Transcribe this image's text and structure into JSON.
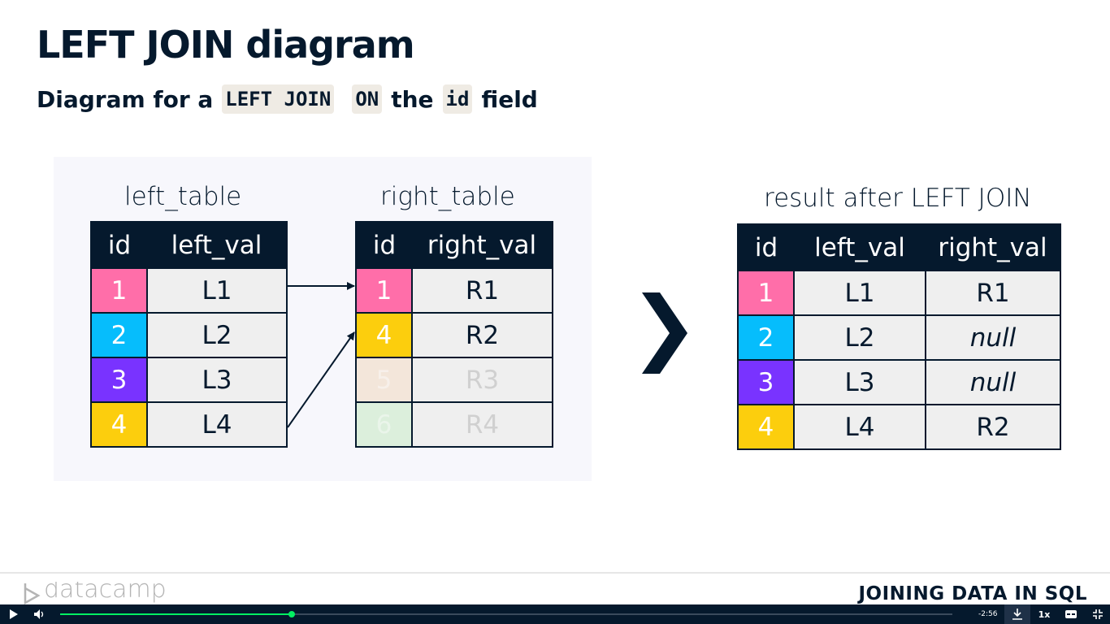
{
  "slide": {
    "title": "LEFT JOIN diagram",
    "subtitle": {
      "prefix": "Diagram for a",
      "code1": "LEFT JOIN",
      "code2": "ON",
      "mid": "the",
      "code3": "id",
      "suffix": "field"
    }
  },
  "left_table": {
    "caption": "left_table",
    "headers": [
      "id",
      "left_val"
    ],
    "rows": [
      {
        "id": "1",
        "val": "L1",
        "color": "#ff6ea9"
      },
      {
        "id": "2",
        "val": "L2",
        "color": "#06bdfc"
      },
      {
        "id": "3",
        "val": "L3",
        "color": "#7933ff"
      },
      {
        "id": "4",
        "val": "L4",
        "color": "#fcce0d"
      }
    ]
  },
  "right_table": {
    "caption": "right_table",
    "headers": [
      "id",
      "right_val"
    ],
    "rows": [
      {
        "id": "1",
        "val": "R1",
        "color": "#ff6ea9"
      },
      {
        "id": "4",
        "val": "R2",
        "color": "#fcce0d"
      },
      {
        "id": "5",
        "val": "R3",
        "color": "#f3e6da"
      },
      {
        "id": "6",
        "val": "R4",
        "color": "#dcefdc"
      }
    ]
  },
  "result_table": {
    "caption": "result after LEFT JOIN",
    "headers": [
      "id",
      "left_val",
      "right_val"
    ],
    "rows": [
      {
        "id": "1",
        "left": "L1",
        "right": "R1"
      },
      {
        "id": "2",
        "left": "L2",
        "right": "null"
      },
      {
        "id": "3",
        "left": "L3",
        "right": "null"
      },
      {
        "id": "4",
        "left": "L4",
        "right": "R2"
      }
    ]
  },
  "footer": {
    "logo_text": "datacamp",
    "course_title": "JOINING DATA IN SQL"
  },
  "player": {
    "time_remaining": "-2:56",
    "speed": "1x",
    "progress_fraction": 0.26,
    "icons": [
      "play-icon",
      "volume-icon",
      "download-icon",
      "captions-icon",
      "exit-fullscreen-icon"
    ]
  },
  "colors": {
    "navy": "#05192d",
    "pink": "#ff6ea9",
    "cyan": "#06bdfc",
    "purple": "#7933ff",
    "yellow": "#fcce0d",
    "green": "#03ef62"
  }
}
